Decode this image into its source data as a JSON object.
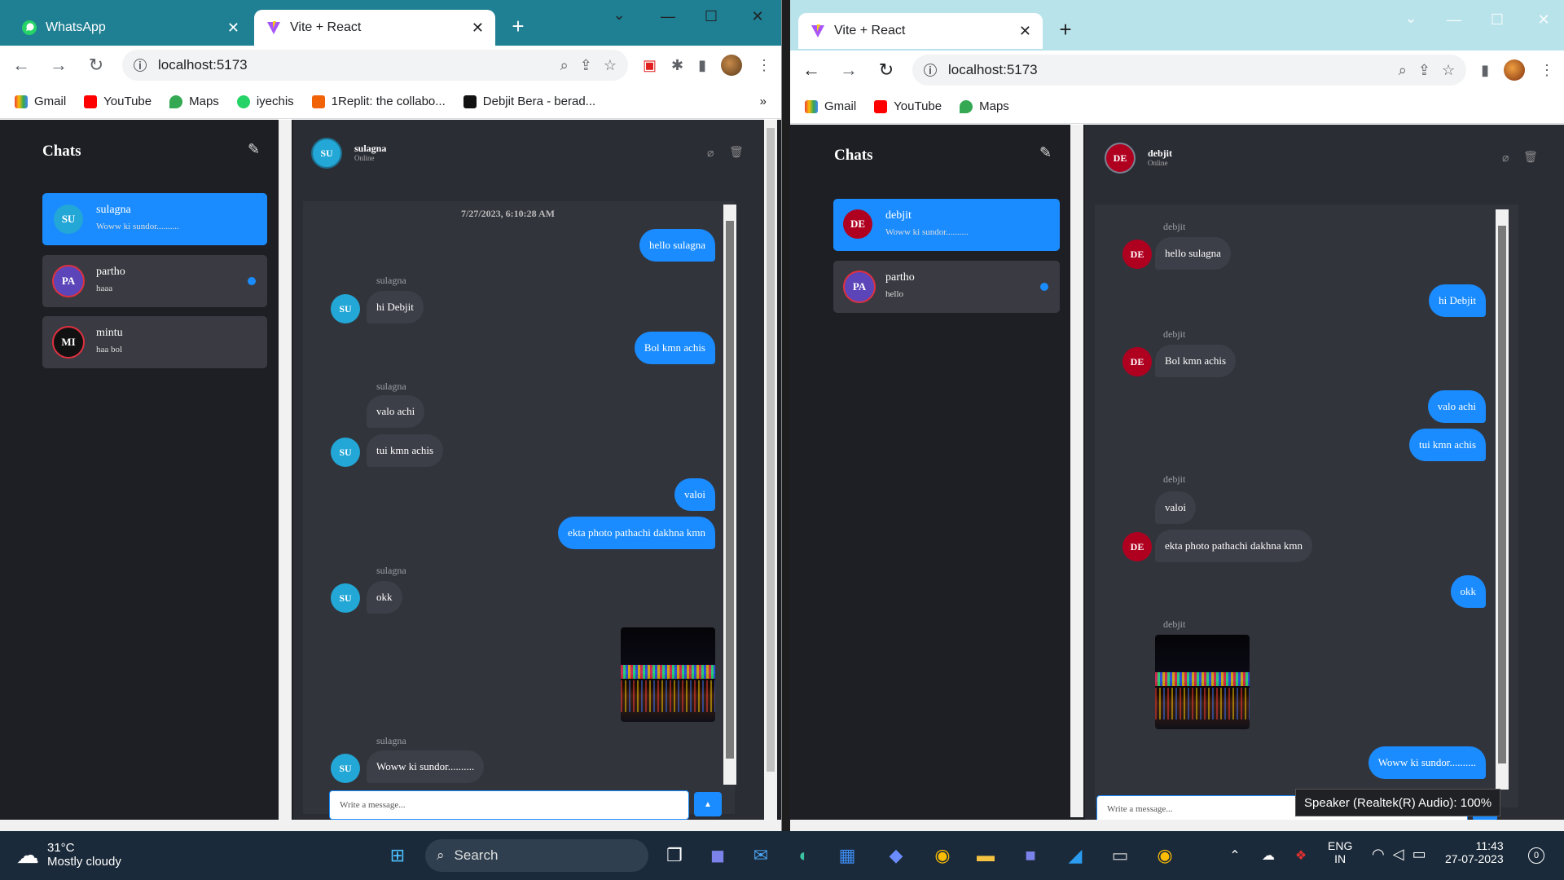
{
  "left_window": {
    "tabs": [
      {
        "title": "WhatsApp"
      },
      {
        "title": "Vite + React"
      }
    ],
    "url": "localhost:5173",
    "bookmarks": [
      "Gmail",
      "YouTube",
      "Maps",
      "iyechis",
      "1Replit: the collabo...",
      "Debjit Bera - berad..."
    ],
    "bookmarks_more": "»",
    "app": {
      "sidebar_title": "Chats",
      "chats": [
        {
          "initials": "SU",
          "name": "sulagna",
          "last": "Woww ki sundor..........",
          "selected": true,
          "unread": false,
          "avatar_color": "#22a7d6"
        },
        {
          "initials": "PA",
          "name": "partho",
          "last": "haaa",
          "selected": false,
          "unread": true,
          "avatar_color": "#5b45b8"
        },
        {
          "initials": "MI",
          "name": "mintu",
          "last": "haa bol",
          "selected": false,
          "unread": false,
          "avatar_color": "#111111"
        }
      ],
      "header": {
        "initials": "SU",
        "name": "sulagna",
        "status": "Online"
      },
      "timestamp": "7/27/2023, 6:10:28 AM",
      "messages": [
        {
          "dir": "out",
          "text": "hello sulagna"
        },
        {
          "dir": "in",
          "sender": "sulagna",
          "initials": "SU",
          "text": "hi Debjit"
        },
        {
          "dir": "out",
          "text": "Bol kmn achis"
        },
        {
          "dir": "in",
          "sender": "sulagna",
          "text": "valo achi"
        },
        {
          "dir": "in",
          "initials": "SU",
          "text": "tui kmn achis"
        },
        {
          "dir": "out",
          "text": "valoi"
        },
        {
          "dir": "out",
          "text": "ekta photo pathachi dakhna kmn"
        },
        {
          "dir": "in",
          "sender": "sulagna",
          "initials": "SU",
          "text": "okk"
        },
        {
          "dir": "in",
          "sender": "sulagna",
          "initials": "SU",
          "text": "Woww ki sundor.........."
        }
      ],
      "input_placeholder": "Write a message...",
      "send_icon": "▲"
    }
  },
  "right_window": {
    "tabs": [
      {
        "title": "Vite + React"
      }
    ],
    "url": "localhost:5173",
    "bookmarks": [
      "Gmail",
      "YouTube",
      "Maps"
    ],
    "app": {
      "sidebar_title": "Chats",
      "chats": [
        {
          "initials": "DE",
          "name": "debjit",
          "last": "Woww ki sundor..........",
          "selected": true,
          "unread": false,
          "avatar_color": "#b00020"
        },
        {
          "initials": "PA",
          "name": "partho",
          "last": "hello",
          "selected": false,
          "unread": true,
          "avatar_color": "#5b45b8"
        }
      ],
      "header": {
        "initials": "DE",
        "name": "debjit",
        "status": "Online"
      },
      "messages": [
        {
          "dir": "in",
          "sender": "debjit",
          "initials": "DE",
          "text": "hello sulagna"
        },
        {
          "dir": "out",
          "text": "hi Debjit"
        },
        {
          "dir": "in",
          "sender": "debjit",
          "initials": "DE",
          "text": "Bol kmn achis"
        },
        {
          "dir": "out",
          "text": "valo achi"
        },
        {
          "dir": "out",
          "text": "tui kmn achis"
        },
        {
          "dir": "in",
          "sender": "debjit",
          "text": "valoi"
        },
        {
          "dir": "in",
          "initials": "DE",
          "text": "ekta photo pathachi dakhna kmn"
        },
        {
          "dir": "out",
          "text": "okk"
        },
        {
          "dir": "in",
          "sender": "debjit"
        },
        {
          "dir": "out",
          "text": "Woww ki sundor.........."
        }
      ],
      "input_placeholder": "Write a message...",
      "send_icon": "▲"
    }
  },
  "tooltip": "Speaker (Realtek(R) Audio): 100%",
  "taskbar": {
    "weather_temp": "31°C",
    "weather_desc": "Mostly cloudy",
    "search_placeholder": "Search",
    "lang_top": "ENG",
    "lang_bottom": "IN",
    "time": "11:43",
    "date": "27-07-2023",
    "notif_count": "0"
  }
}
